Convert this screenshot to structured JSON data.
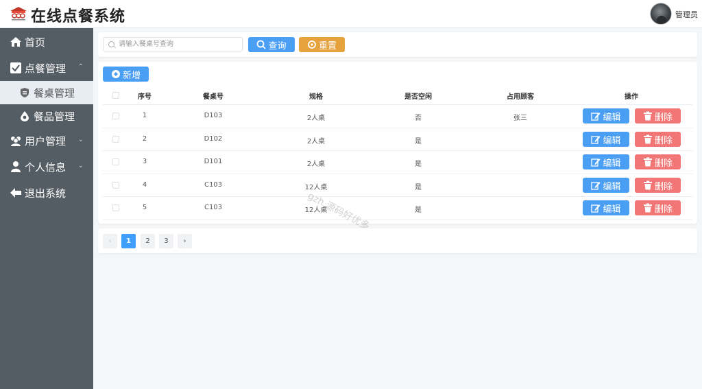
{
  "header": {
    "title": "在线点餐系统",
    "username": "管理员"
  },
  "sidebar": {
    "items": [
      {
        "label": "首页"
      },
      {
        "label": "点餐管理",
        "arrow": "⌃"
      },
      {
        "label": "餐桌管理"
      },
      {
        "label": "餐品管理"
      },
      {
        "label": "用户管理",
        "arrow": "⌄"
      },
      {
        "label": "个人信息",
        "arrow": "⌄"
      },
      {
        "label": "退出系统"
      }
    ]
  },
  "search": {
    "placeholder": "请输入餐桌号查询",
    "query_label": "查询",
    "reset_label": "重置"
  },
  "toolbar": {
    "add_label": "新增"
  },
  "table": {
    "columns": [
      "序号",
      "餐桌号",
      "规格",
      "是否空闲",
      "占用顾客",
      "操作"
    ],
    "rows": [
      [
        "1",
        "D103",
        "2人桌",
        "否",
        "张三"
      ],
      [
        "2",
        "D102",
        "2人桌",
        "是",
        ""
      ],
      [
        "3",
        "D101",
        "2人桌",
        "是",
        ""
      ],
      [
        "4",
        "C103",
        "12人桌",
        "是",
        ""
      ],
      [
        "5",
        "C103",
        "12人桌",
        "是",
        ""
      ]
    ],
    "edit_label": "编辑",
    "delete_label": "删除"
  },
  "pagination": {
    "prev": "‹",
    "pages": [
      "1",
      "2",
      "3"
    ],
    "next": "›"
  },
  "watermark": "gzh 源码好优多",
  "colors": {
    "sidebar": "#545c64",
    "primary": "#409eff",
    "warning": "#e6a23c",
    "danger": "#f27676"
  }
}
